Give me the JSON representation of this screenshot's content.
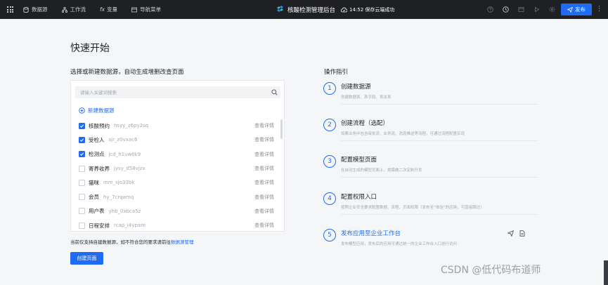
{
  "topbar": {
    "nav": [
      {
        "label": "数据源",
        "icon": "database-icon"
      },
      {
        "label": "工作流",
        "icon": "workflow-icon"
      },
      {
        "label": "变量",
        "icon": "fx-icon"
      },
      {
        "label": "导航菜单",
        "icon": "menu-icon"
      }
    ],
    "app_title": "核酸检测管理后台",
    "save_status": "14:52 保存云端成功",
    "publish_label": "发布",
    "more": "⋮"
  },
  "page": {
    "title": "快速开始",
    "left_subtitle": "选择或新建数据源，自动生成增删改查页面",
    "right_subtitle": "操作指引"
  },
  "datasource": {
    "search_placeholder": "请输入关键词搜索",
    "new_label": "新建数据源",
    "detail_label": "查看详情",
    "items": [
      {
        "name": "核酸预约",
        "code": "hsyy_z6py2sq",
        "checked": true
      },
      {
        "name": "受检人",
        "code": "sjr_z0vxac6",
        "checked": true
      },
      {
        "name": "检测点",
        "code": "jcd_h1uw0k9",
        "checked": true
      },
      {
        "name": "寄养收养",
        "code": "jysy_d58vjzx",
        "checked": false
      },
      {
        "name": "猫咪",
        "code": "mm_sjo33bk",
        "checked": false
      },
      {
        "name": "会员",
        "code": "hy_7crqamq",
        "checked": false
      },
      {
        "name": "用户表",
        "code": "yhb_0xbca5z",
        "checked": false
      },
      {
        "name": "日程安排",
        "code": "rcap_i4ypare",
        "checked": false
      }
    ],
    "note_text": "当前仅支持自建数据源，如不符合您的要求请前往",
    "note_link": "数据源管理",
    "create_label": "创建页面"
  },
  "guide": {
    "steps": [
      {
        "num": "1",
        "title": "创建数据源",
        "desc": "创建数据表、表字段、表关系"
      },
      {
        "num": "2",
        "title": "创建流程（选配）",
        "desc": "如果业务中包含审批流、业务流、消息推送等流程，可通过流程配置实现"
      },
      {
        "num": "3",
        "title": "配置模型页面",
        "desc": "在自动生成的模型页面上，按需做二次定制开发"
      },
      {
        "num": "4",
        "title": "配置权限入口",
        "desc": "按照企业安全要求配置数据、流程、页面权限（发布至“体验”的应用，可直接跳过）"
      },
      {
        "num": "5",
        "title": "发布应用至企业工作台",
        "desc": "发布模型应用，发布后的应用可通过统一的企业工作台入口进行访问"
      }
    ]
  },
  "watermark": "CSDN @低代码布道师",
  "colors": {
    "accent": "#1f6bf1",
    "topbar": "#1f2024",
    "background": "#f5f6f8"
  }
}
